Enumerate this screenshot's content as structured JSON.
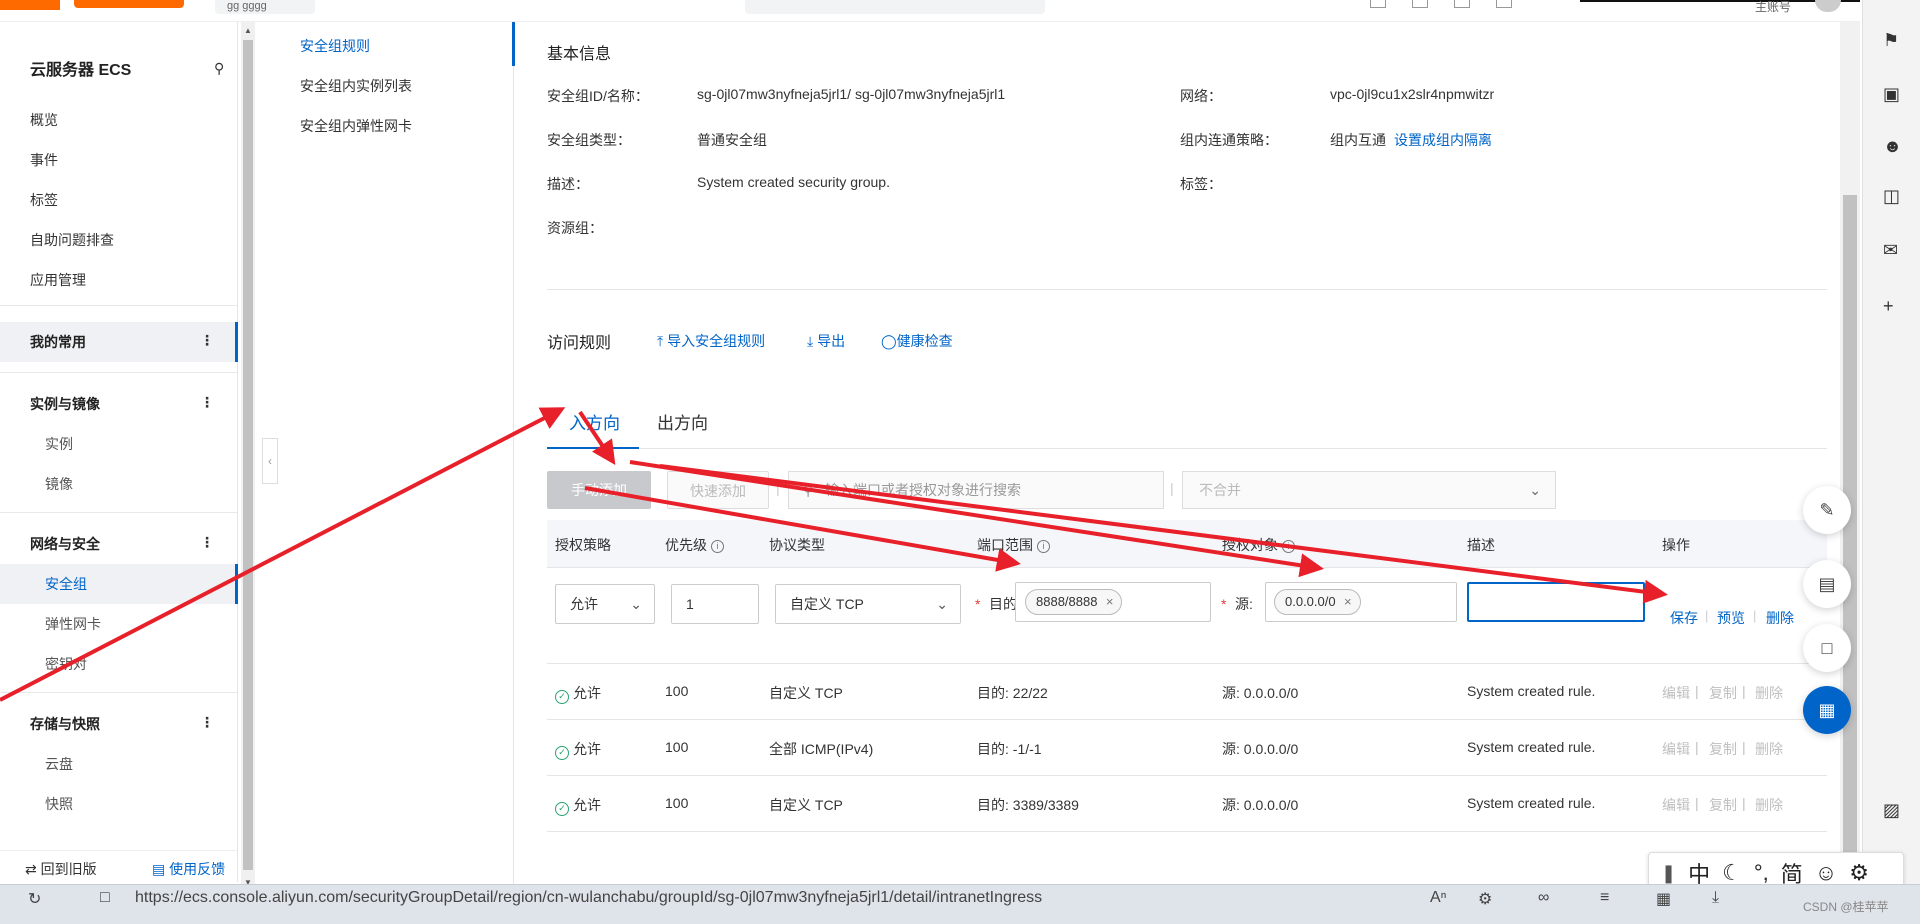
{
  "topbar": {
    "workspace": "ɡɡ ɡɡɡɡ",
    "account": "主账号"
  },
  "leftnav": {
    "title": "云服务器 ECS",
    "top_items": [
      "概览",
      "事件",
      "标签",
      "自助问题排查",
      "应用管理"
    ],
    "fav_group": "我的常用",
    "group1": "实例与镜像",
    "group1_items": [
      "实例",
      "镜像"
    ],
    "group2": "网络与安全",
    "group2_items": [
      "安全组",
      "弹性网卡",
      "密钥对"
    ],
    "group3": "存储与快照",
    "group3_items": [
      "云盘",
      "快照"
    ],
    "old_version": "回到旧版",
    "feedback": "使用反馈"
  },
  "subnav": {
    "items": [
      "安全组规则",
      "安全组内实例列表",
      "安全组内弹性网卡"
    ]
  },
  "basic": {
    "title": "基本信息",
    "id_label": "安全组ID/名称：",
    "id_value": "sg-0jl07mw3nyfneja5jrl1/ sg-0jl07mw3nyfneja5jrl1",
    "type_label": "安全组类型：",
    "type_value": "普通安全组",
    "desc_label": "描述：",
    "desc_value": "System created security group.",
    "rg_label": "资源组：",
    "net_label": "网络：",
    "net_value": "vpc-0jl9cu1x2slr4npmwitzr",
    "policy_label": "组内连通策略：",
    "policy_value": "组内互通",
    "policy_link": "设置成组内隔离",
    "tag_label": "标签："
  },
  "rules": {
    "title": "访问规则",
    "import": "导入安全组规则",
    "export": "导出",
    "health": "健康检查",
    "tab_in": "入方向",
    "tab_out": "出方向",
    "manual_add": "手动添加",
    "quick_add": "快速添加",
    "search_placeholder": "输入端口或者授权对象进行搜索",
    "merge_select": "不合并",
    "headers": {
      "policy": "授权策略",
      "priority": "优先级",
      "protocol": "协议类型",
      "port": "端口范围",
      "target": "授权对象",
      "desc": "描述",
      "action": "操作"
    },
    "edit": {
      "policy": "允许",
      "priority": "1",
      "protocol": "自定义 TCP",
      "dest_label": "目的:",
      "dest_tag": "8888/8888",
      "src_label": "源:",
      "src_tag": "0.0.0.0/0",
      "save": "保存",
      "preview": "预览",
      "delete": "删除"
    },
    "rows": [
      {
        "policy": "允许",
        "priority": "100",
        "protocol": "自定义 TCP",
        "port": "目的: 22/22",
        "target": "源: 0.0.0.0/0",
        "desc": "System created rule."
      },
      {
        "policy": "允许",
        "priority": "100",
        "protocol": "全部 ICMP(IPv4)",
        "port": "目的: -1/-1",
        "target": "源: 0.0.0.0/0",
        "desc": "System created rule."
      },
      {
        "policy": "允许",
        "priority": "100",
        "protocol": "自定义 TCP",
        "port": "目的: 3389/3389",
        "target": "源: 0.0.0.0/0",
        "desc": "System created rule."
      }
    ],
    "row_actions": {
      "edit": "编辑",
      "copy": "复制",
      "delete": "删除"
    }
  },
  "ime": {
    "mode": "中",
    "simplified": "简"
  },
  "browser": {
    "url": "https://ecs.console.aliyun.com/securityGroupDetail/region/cn-wulanchabu/groupId/sg-0jl07mw3nyfneja5jrl1/detail/intranetIngress",
    "watermark": "CSDN @桂苹苹"
  },
  "colors": {
    "accent": "#0064c8",
    "annotation": "#e8202a",
    "ok": "#2ba471"
  }
}
